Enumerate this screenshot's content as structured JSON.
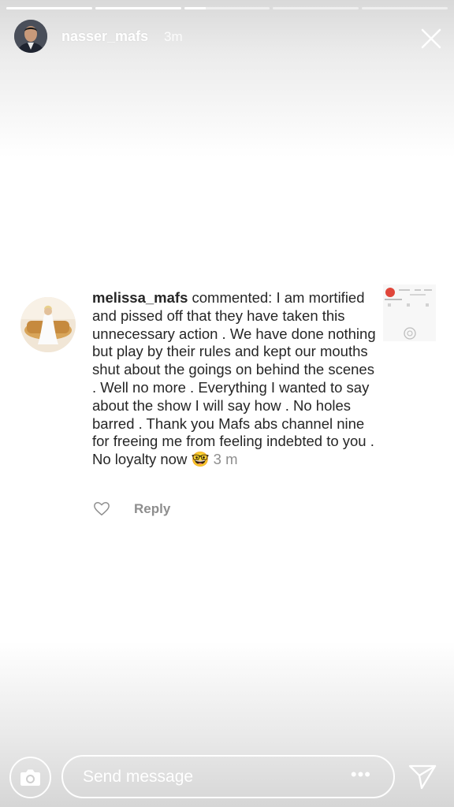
{
  "story": {
    "progress": [
      1,
      1,
      0.25,
      0,
      0
    ]
  },
  "header": {
    "username": "nasser_mafs",
    "time": "3m",
    "close_icon": "close-icon"
  },
  "comment": {
    "username": "melissa_mafs",
    "text": "commented: I am mortified and pissed off that they have taken this unnecessary action . We have done nothing but play by their rules and kept our mouths shut about the goings on behind the scenes . Well no more . Everything I wanted to say about the show I will say how . No holes barred . Thank you Mafs abs channel nine for freeing me from feeling indebted to you . No loyalty now",
    "emoji": "🤓",
    "time": "3 m",
    "reply_label": "Reply"
  },
  "footer": {
    "camera_icon": "camera-icon",
    "message_placeholder": "Send message",
    "more_label": "•••",
    "send_icon": "send-icon"
  },
  "colors": {
    "text": "#262626",
    "muted": "#8e8e8e"
  }
}
